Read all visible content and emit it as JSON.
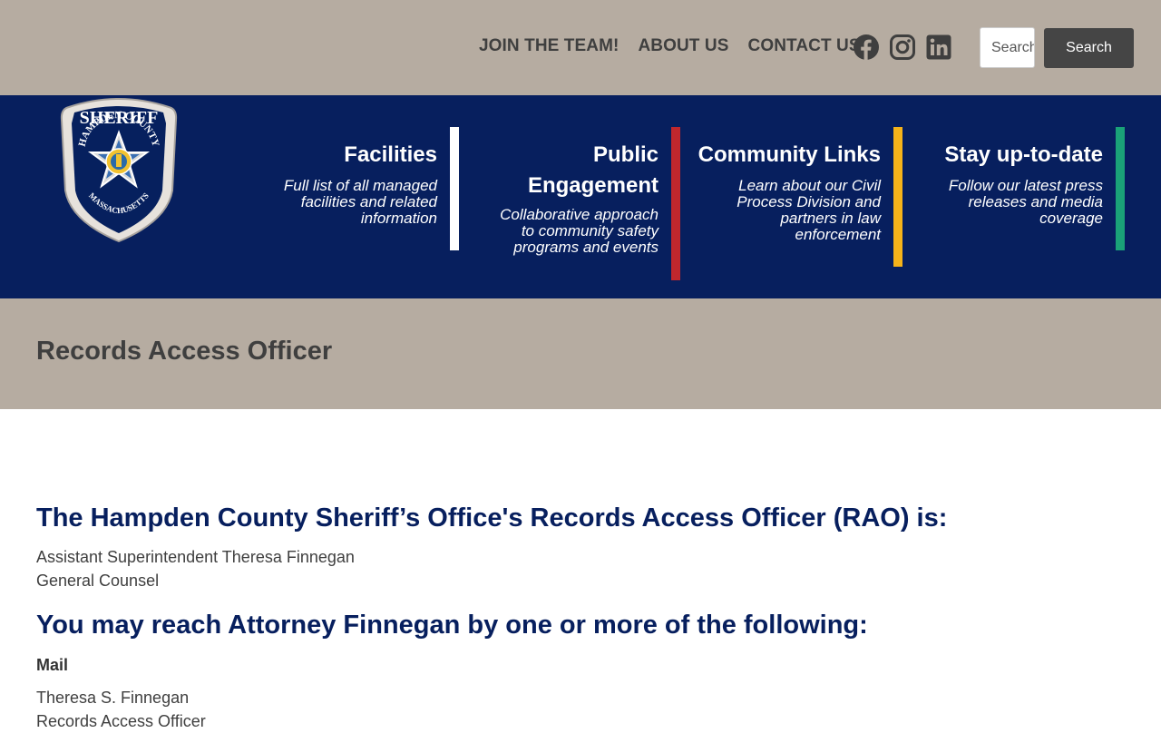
{
  "header": {
    "nav": [
      "JOIN THE TEAM!",
      "ABOUT US",
      "CONTACT US"
    ],
    "social_icons": [
      "facebook-icon",
      "instagram-icon",
      "linkedin-icon"
    ],
    "search": {
      "placeholder": "Search",
      "button_label": "Search"
    }
  },
  "logo": {
    "top_text": "SHERIFF",
    "ring_text": "HAMPDEN COUNTY",
    "bottom_text": "MASSACHUSETTS"
  },
  "main_nav": [
    {
      "title": "Facilities",
      "desc": "Full list of all managed facilities and related information",
      "color": "#ffffff"
    },
    {
      "title": "Public Engagement",
      "desc": "Collaborative approach to community safety programs and events",
      "color": "#c0272d"
    },
    {
      "title": "Community Links",
      "desc": "Learn about our Civil Process Division and partners in law enforcement",
      "color": "#f5b31a"
    },
    {
      "title": "Stay up-to-date",
      "desc": "Follow our latest press releases and media coverage",
      "color": "#1aa278"
    }
  ],
  "page": {
    "title": "Records Access Officer",
    "heading1": "The Hampden County Sheriff’s Office's Records Access Officer (RAO) is:",
    "officer_name": "Assistant Superintendent Theresa Finnegan",
    "officer_title": "General Counsel",
    "heading2": "You may reach Attorney Finnegan by one or more of the following:",
    "mail_label": "Mail",
    "mail_name": "Theresa S. Finnegan",
    "mail_role": "Records Access Officer"
  },
  "colors": {
    "navy": "#071f5e",
    "tan": "#b6aca1",
    "dark_gray": "#454545"
  }
}
